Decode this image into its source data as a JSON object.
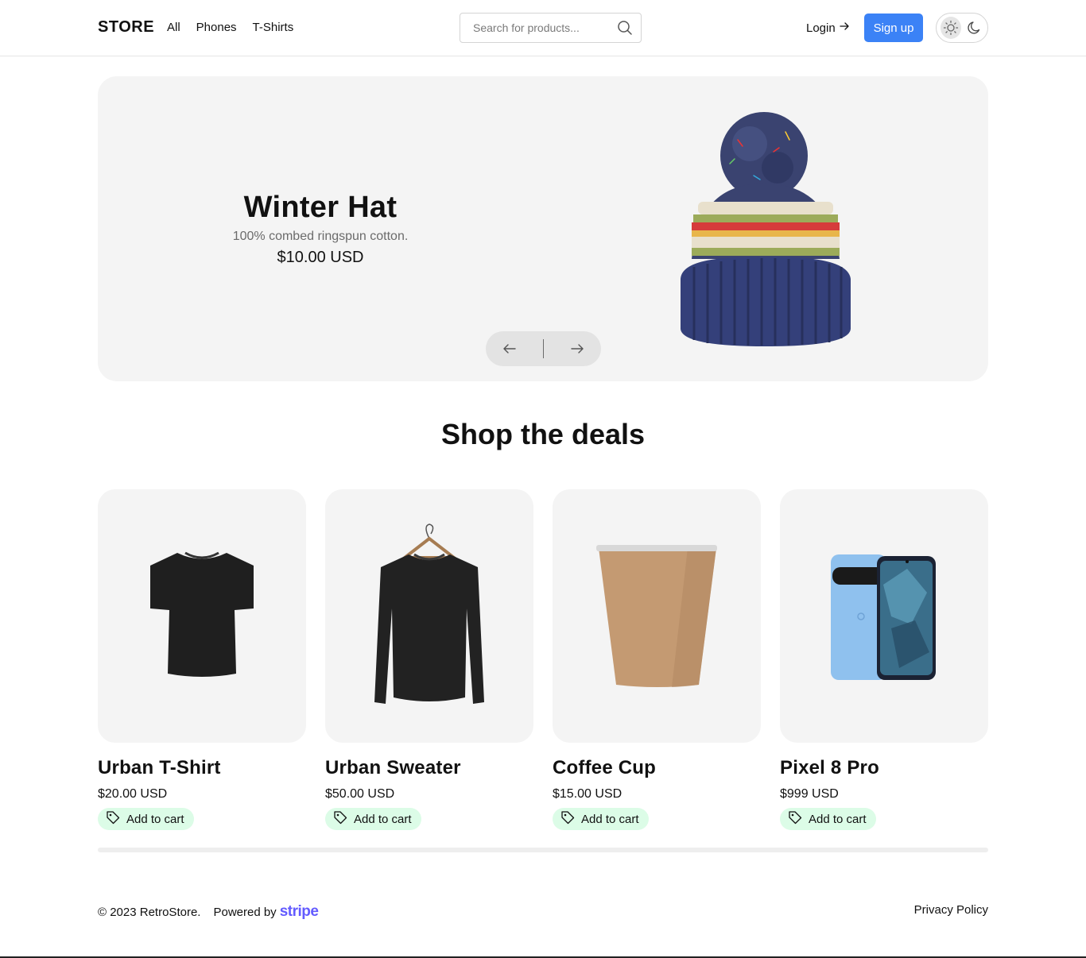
{
  "header": {
    "logo": "STORE",
    "nav": [
      "All",
      "Phones",
      "T-Shirts"
    ],
    "search_placeholder": "Search for products...",
    "login_label": "Login",
    "signup_label": "Sign up"
  },
  "hero": {
    "title": "Winter Hat",
    "description": "100% combed ringspun cotton.",
    "price": "$10.00 USD"
  },
  "deals": {
    "title": "Shop the deals",
    "products": [
      {
        "name": "Urban T-Shirt",
        "price": "$20.00 USD",
        "cart_label": "Add to cart"
      },
      {
        "name": "Urban Sweater",
        "price": "$50.00 USD",
        "cart_label": "Add to cart"
      },
      {
        "name": "Coffee Cup",
        "price": "$15.00 USD",
        "cart_label": "Add to cart"
      },
      {
        "name": "Pixel 8 Pro",
        "price": "$999 USD",
        "cart_label": "Add to cart"
      }
    ]
  },
  "footer": {
    "copyright": "© 2023 RetroStore.",
    "powered_by": "Powered by",
    "powered_brand": "stripe",
    "privacy": "Privacy Policy"
  },
  "colors": {
    "accent": "#3b82f6",
    "cart_bg": "#dcfce7",
    "panel_bg": "#f4f4f4",
    "stripe": "#635bff"
  }
}
